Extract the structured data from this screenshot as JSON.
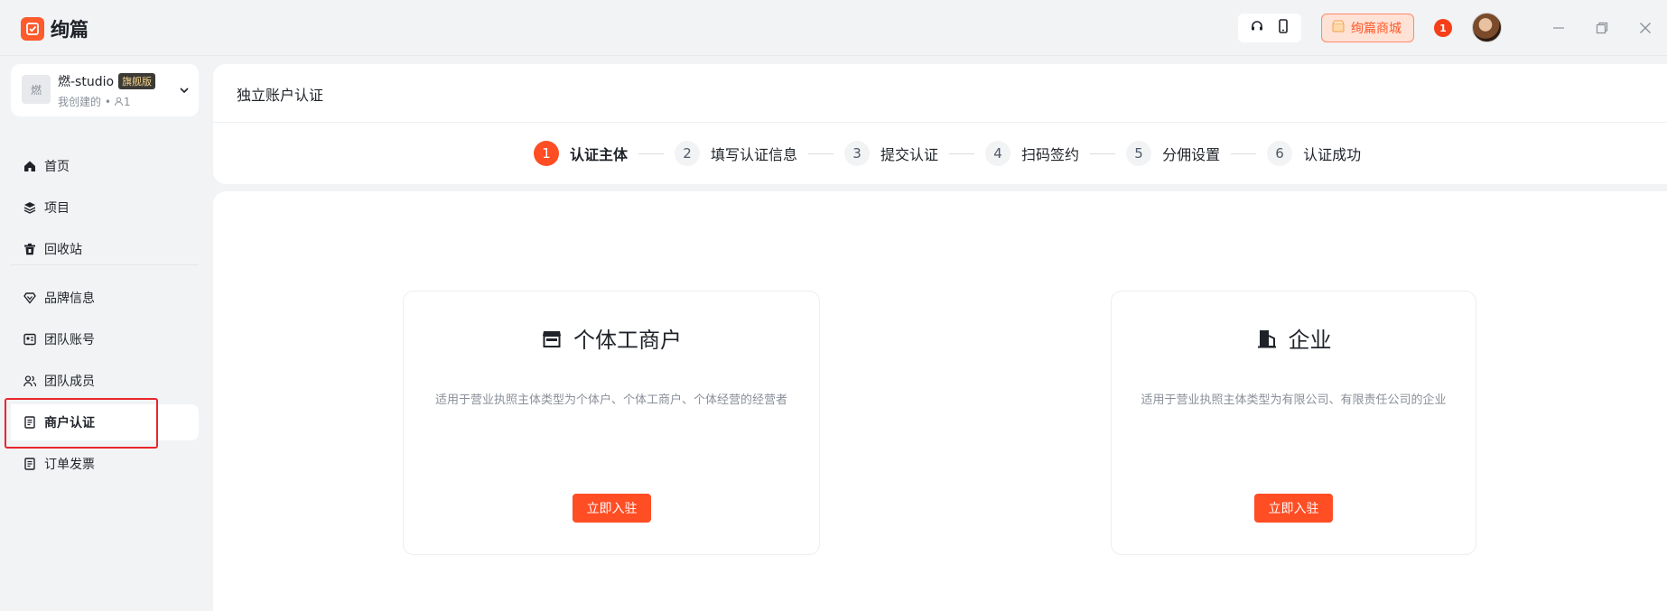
{
  "app": {
    "name": "绚篇"
  },
  "topbar": {
    "mall_label": "绚篇商城",
    "notify_count": "1",
    "icons": [
      "headset-icon",
      "phone-icon",
      "shop-icon",
      "minimize-icon",
      "restore-icon",
      "close-icon"
    ]
  },
  "team": {
    "avatar_char": "燃",
    "name": "燃-studio",
    "tag": "旗舰版",
    "meta": "我创建的 •",
    "member_count": "1"
  },
  "sidebar": {
    "items": [
      {
        "label": "首页",
        "icon": "home-icon"
      },
      {
        "label": "项目",
        "icon": "layers-icon"
      },
      {
        "label": "回收站",
        "icon": "trash-icon"
      },
      {
        "label": "品牌信息",
        "icon": "diamond-icon"
      },
      {
        "label": "团队账号",
        "icon": "id-card-icon"
      },
      {
        "label": "团队成员",
        "icon": "users-icon"
      },
      {
        "label": "商户认证",
        "icon": "document-icon",
        "active": true
      },
      {
        "label": "订单发票",
        "icon": "invoice-icon"
      }
    ]
  },
  "header": {
    "title": "独立账户认证",
    "steps": [
      {
        "num": "1",
        "label": "认证主体",
        "active": true
      },
      {
        "num": "2",
        "label": "填写认证信息"
      },
      {
        "num": "3",
        "label": "提交认证"
      },
      {
        "num": "4",
        "label": "扫码签约"
      },
      {
        "num": "5",
        "label": "分佣设置"
      },
      {
        "num": "6",
        "label": "认证成功"
      }
    ]
  },
  "cards": [
    {
      "title": "个体工商户",
      "icon": "storefront-icon",
      "desc": "适用于营业执照主体类型为个体户、个体工商户、个体经营的经营者",
      "button": "立即入驻"
    },
    {
      "title": "企业",
      "icon": "building-icon",
      "desc": "适用于营业执照主体类型为有限公司、有限责任公司的企业",
      "button": "立即入驻"
    }
  ],
  "colors": {
    "accent": "#ff4d24",
    "highlight": "#e8262b"
  }
}
